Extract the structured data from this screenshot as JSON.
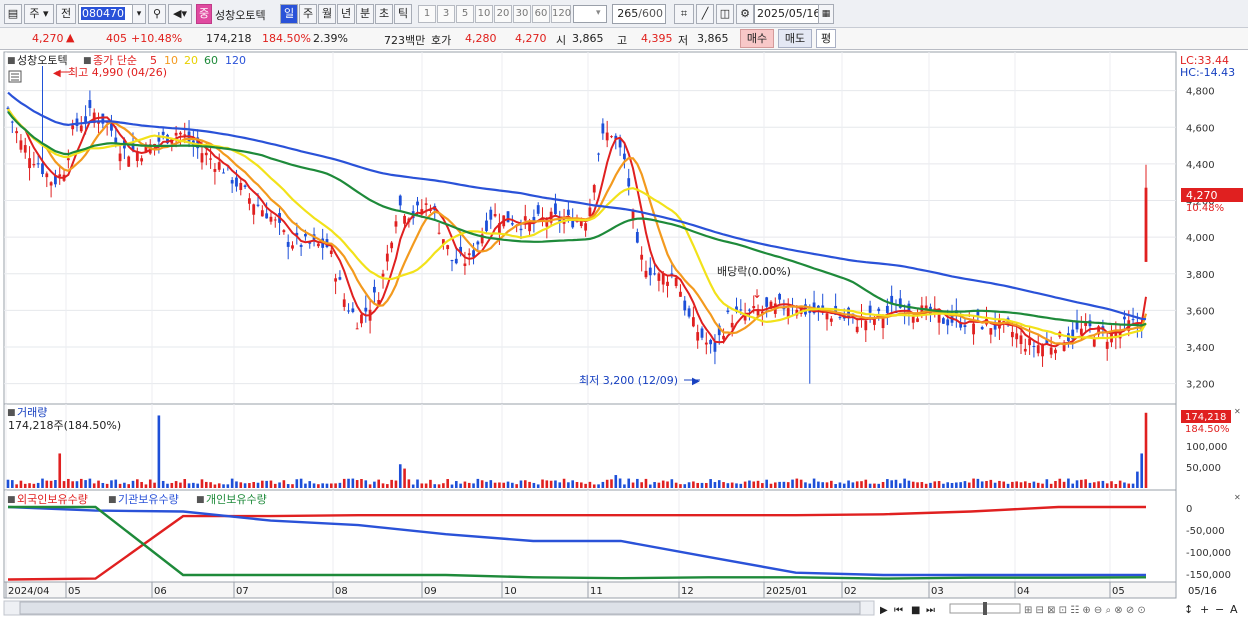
{
  "toolbar": {
    "market_label": "주",
    "prev_label": "전",
    "code_value": "080470",
    "stock_name": "성창오토텍",
    "stock_badge": "중",
    "periods": [
      "일",
      "주",
      "월",
      "년",
      "분",
      "초",
      "틱"
    ],
    "active_period": "일",
    "intervals": [
      "1",
      "3",
      "5",
      "10",
      "20",
      "30",
      "60",
      "120"
    ],
    "count_value": "265",
    "count_total": "/600",
    "date_value": "2025/05/16"
  },
  "quote": {
    "price": "4,270",
    "change": "405",
    "change_pct": "+10.48%",
    "volume": "174,218",
    "volume_ratio": "184.50%",
    "turnover": "2.39%",
    "amount": "723백만",
    "bid_label": "호가",
    "ask_price": "4,280",
    "bid_price": "4,270",
    "open_label": "시",
    "open": "3,865",
    "high_label": "고",
    "high": "4,395",
    "low_label": "저",
    "low": "3,865",
    "buy_label": "매수",
    "sell_label": "매도",
    "eval_label": "평"
  },
  "legend": {
    "title": "성창오토텍",
    "ma_prefix": "종가 단순",
    "ma_periods": [
      "5",
      "10",
      "20",
      "60",
      "120"
    ],
    "ma_colors": [
      "#e02020",
      "#f39a1e",
      "#f2e21a",
      "#1e8a3a",
      "#2a52d8"
    ],
    "high_annotation": "최고 4,990 (04/26)",
    "low_annotation": "최저 3,200 (12/09)",
    "dividend_annotation": "배당락(0.00%)",
    "lc": "LC:33.44",
    "hc": "HC:-14.43",
    "last_price": "4,270",
    "last_pct": "10.48%"
  },
  "volume_panel": {
    "title": "거래량",
    "info": "174,218주(184.50%)",
    "last": "174,218",
    "last_pct": "184.50%"
  },
  "holdings_panel": {
    "series": [
      "외국인보유수량",
      "기관보유수량",
      "개인보유수량"
    ],
    "colors": [
      "#e02020",
      "#2a52d8",
      "#1e8a3a"
    ]
  },
  "chart_data": [
    {
      "type": "line",
      "title": "성창오토텍",
      "ylim": [
        3100,
        5000
      ],
      "yticks": [
        "4,800",
        "4,600",
        "4,400",
        "4,200",
        "4,000",
        "3,800",
        "3,600",
        "3,400",
        "3,200"
      ],
      "x": [
        "2024/04",
        "05",
        "06",
        "07",
        "08",
        "09",
        "10",
        "11",
        "12",
        "2025/01",
        "02",
        "03",
        "04",
        "05"
      ],
      "series": [
        {
          "name": "5",
          "values": [
            4450,
            4420,
            4550,
            4100,
            3900,
            3550,
            4050,
            4120,
            4450,
            3520,
            3620,
            3580,
            3520,
            3460,
            3500,
            3700
          ]
        },
        {
          "name": "120",
          "values": [
            4880,
            4780,
            4660,
            4560,
            4420,
            4340,
            4260,
            4180,
            4120,
            3990,
            3880,
            3820,
            3760,
            3700,
            3620,
            3590
          ]
        }
      ],
      "last_close": 4270,
      "high": {
        "value": 4990,
        "date": "04/26"
      },
      "low": {
        "value": 3200,
        "date": "12/09"
      }
    },
    {
      "type": "bar",
      "title": "거래량",
      "yticks": [
        "100,000",
        "50,000"
      ],
      "last_value": 174218
    },
    {
      "type": "line",
      "series": [
        {
          "name": "외국인보유수량",
          "values": [
            -160000,
            -158000,
            -20000,
            -20000,
            -18000,
            -18000,
            -18000,
            -18000,
            -18000,
            -18000,
            -16000,
            -10000,
            0,
            0
          ]
        },
        {
          "name": "기관보유수량",
          "values": [
            0,
            -8000,
            -10000,
            -30000,
            -40000,
            -60000,
            -75000,
            -75000,
            -110000,
            -145000,
            -150000,
            -150000,
            -150000,
            -150000
          ]
        },
        {
          "name": "개인보유수량",
          "values": [
            0,
            0,
            -150000,
            -150000,
            -150000,
            -150000,
            -155000,
            -157000,
            -155000,
            -155000,
            -158000,
            -156000,
            -156000,
            -155000
          ]
        }
      ],
      "yticks": [
        "0",
        "-50,000",
        "-100,000",
        "-150,000"
      ]
    }
  ]
}
